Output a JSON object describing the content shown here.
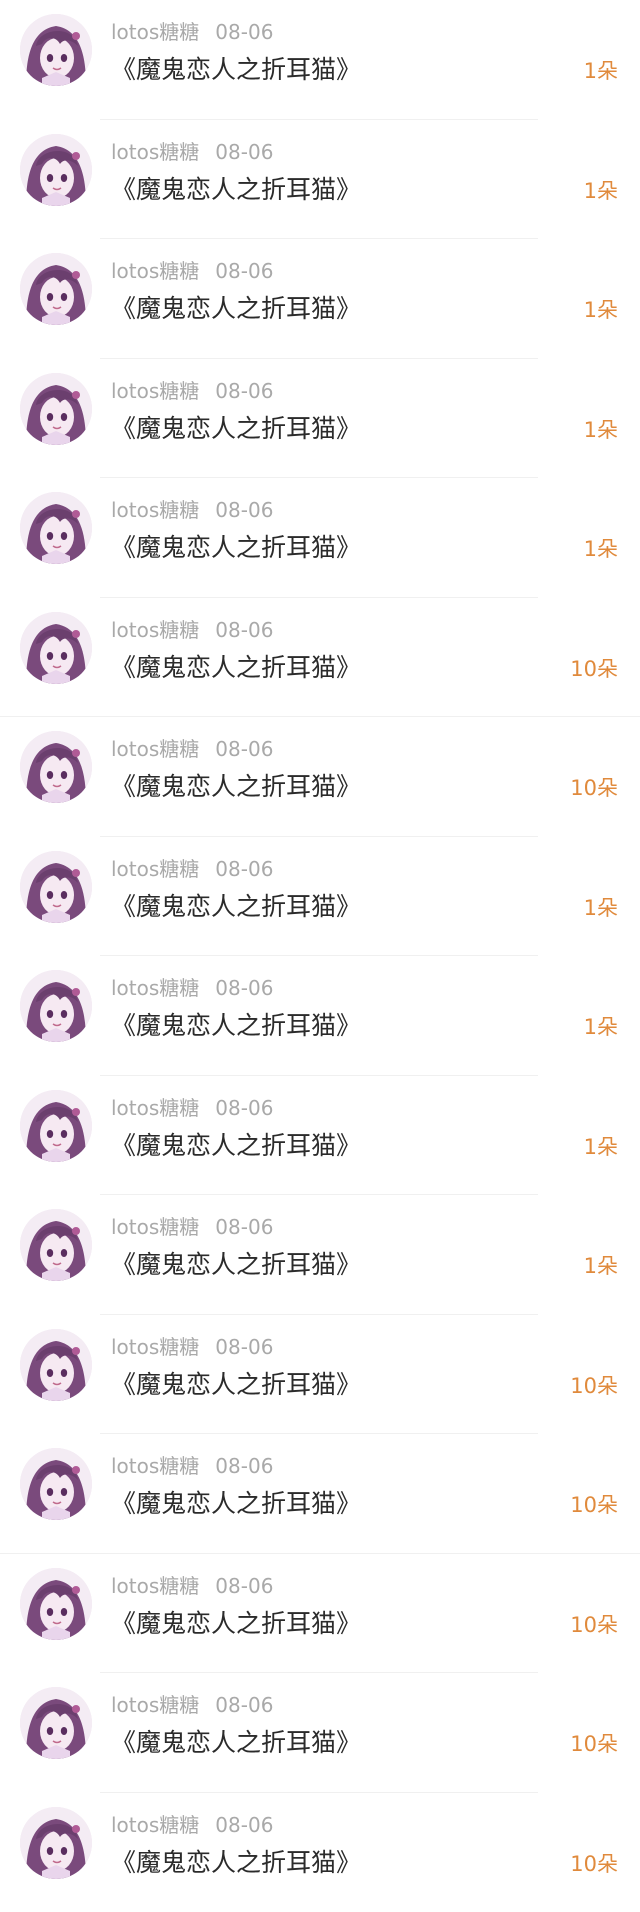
{
  "gift_records": [
    {
      "user": "lotos糖糖",
      "date": "08-06",
      "title": "《魔鬼恋人之折耳猫》",
      "amount": "1朵"
    },
    {
      "user": "lotos糖糖",
      "date": "08-06",
      "title": "《魔鬼恋人之折耳猫》",
      "amount": "1朵"
    },
    {
      "user": "lotos糖糖",
      "date": "08-06",
      "title": "《魔鬼恋人之折耳猫》",
      "amount": "1朵"
    },
    {
      "user": "lotos糖糖",
      "date": "08-06",
      "title": "《魔鬼恋人之折耳猫》",
      "amount": "1朵"
    },
    {
      "user": "lotos糖糖",
      "date": "08-06",
      "title": "《魔鬼恋人之折耳猫》",
      "amount": "1朵"
    },
    {
      "user": "lotos糖糖",
      "date": "08-06",
      "title": "《魔鬼恋人之折耳猫》",
      "amount": "10朵"
    },
    {
      "user": "lotos糖糖",
      "date": "08-06",
      "title": "《魔鬼恋人之折耳猫》",
      "amount": "10朵"
    },
    {
      "user": "lotos糖糖",
      "date": "08-06",
      "title": "《魔鬼恋人之折耳猫》",
      "amount": "1朵"
    },
    {
      "user": "lotos糖糖",
      "date": "08-06",
      "title": "《魔鬼恋人之折耳猫》",
      "amount": "1朵"
    },
    {
      "user": "lotos糖糖",
      "date": "08-06",
      "title": "《魔鬼恋人之折耳猫》",
      "amount": "1朵"
    },
    {
      "user": "lotos糖糖",
      "date": "08-06",
      "title": "《魔鬼恋人之折耳猫》",
      "amount": "1朵"
    },
    {
      "user": "lotos糖糖",
      "date": "08-06",
      "title": "《魔鬼恋人之折耳猫》",
      "amount": "10朵"
    },
    {
      "user": "lotos糖糖",
      "date": "08-06",
      "title": "《魔鬼恋人之折耳猫》",
      "amount": "10朵"
    },
    {
      "user": "lotos糖糖",
      "date": "08-06",
      "title": "《魔鬼恋人之折耳猫》",
      "amount": "10朵"
    },
    {
      "user": "lotos糖糖",
      "date": "08-06",
      "title": "《魔鬼恋人之折耳猫》",
      "amount": "10朵"
    },
    {
      "user": "lotos糖糖",
      "date": "08-06",
      "title": "《魔鬼恋人之折耳猫》",
      "amount": "10朵"
    }
  ],
  "colors": {
    "background": "#ffffff",
    "username": "#a9a9a9",
    "title": "#2b2b2b",
    "amount": "#e08a3c",
    "divider": "#f0f0f0",
    "avatar_hair": "#7a4a7c",
    "avatar_skin": "#f3e6ef"
  },
  "icons": {
    "avatar": "anime-girl-avatar-icon"
  }
}
